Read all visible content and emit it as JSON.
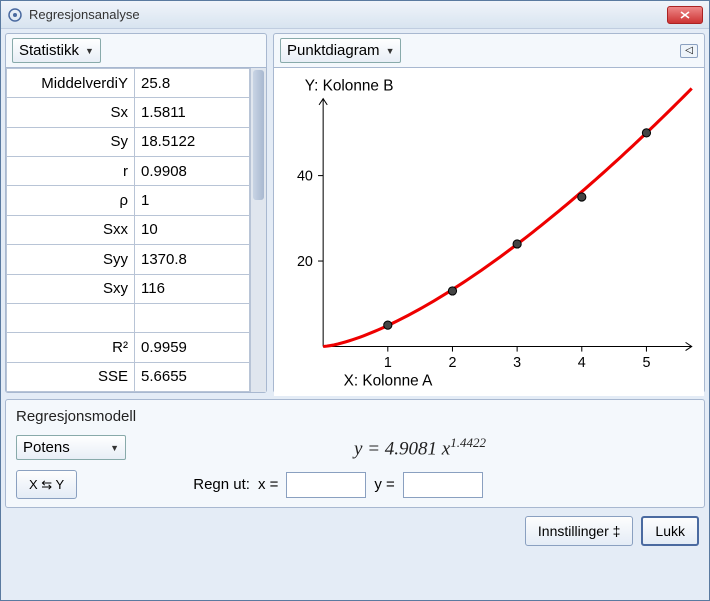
{
  "window": {
    "title": "Regresjonsanalyse"
  },
  "stats": {
    "dropdown_label": "Statistikk",
    "rows": [
      {
        "label": "MiddelverdiY",
        "value": "25.8"
      },
      {
        "label": "Sx",
        "value": "1.5811"
      },
      {
        "label": "Sy",
        "value": "18.5122"
      },
      {
        "label": "r",
        "value": "0.9908"
      },
      {
        "label": "ρ",
        "value": "1"
      },
      {
        "label": "Sxx",
        "value": "10"
      },
      {
        "label": "Syy",
        "value": "1370.8"
      },
      {
        "label": "Sxy",
        "value": "116"
      },
      {
        "label": "",
        "value": ""
      },
      {
        "label": "R²",
        "value": "0.9959"
      },
      {
        "label": "SSE",
        "value": "5.6655"
      }
    ]
  },
  "chart": {
    "dropdown_label": "Punktdiagram",
    "y_title": "Y:  Kolonne B",
    "x_title": "X:  Kolonne A"
  },
  "model": {
    "section_title": "Regresjonsmodell",
    "dropdown_label": "Potens",
    "equation_prefix": "y = 4.9081 x",
    "equation_exp": "1.4422",
    "swap_label": "X ⇆ Y",
    "calc_label": "Regn ut:",
    "x_label": "x =",
    "y_label": "y =",
    "x_value": "",
    "y_value": ""
  },
  "footer": {
    "settings_label": "Innstillinger ‡",
    "close_label": "Lukk"
  },
  "chart_data": {
    "type": "scatter",
    "title": "",
    "xlabel": "X:  Kolonne A",
    "ylabel": "Y:  Kolonne B",
    "x": [
      1,
      2,
      3,
      4,
      5
    ],
    "y": [
      5,
      13,
      24,
      35,
      50
    ],
    "fit": {
      "type": "power",
      "a": 4.9081,
      "b": 1.4422
    },
    "xlim": [
      0,
      5.7
    ],
    "ylim": [
      0,
      58
    ],
    "xticks": [
      1,
      2,
      3,
      4,
      5
    ],
    "yticks": [
      20,
      40
    ]
  }
}
